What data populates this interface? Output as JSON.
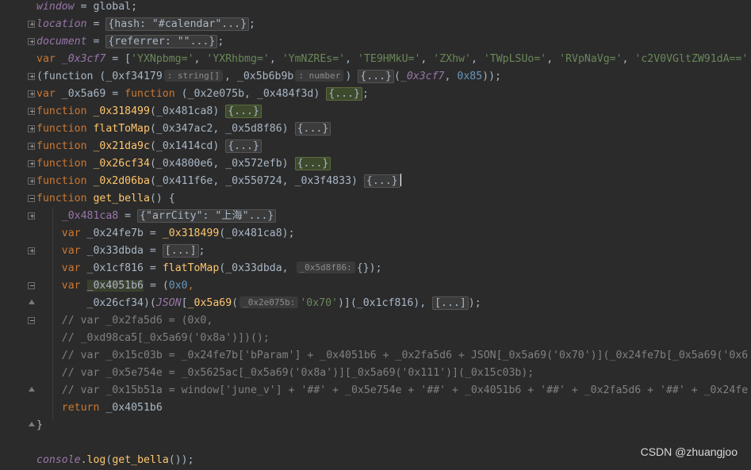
{
  "editor": {
    "lines": [
      {
        "n": 0,
        "tokens": [
          [
            "gl",
            "window"
          ],
          [
            "plain",
            " = global;"
          ]
        ]
      },
      {
        "n": 1,
        "tokens": [
          [
            "gl",
            "location"
          ],
          [
            "plain",
            " = "
          ],
          [
            "fold",
            "{hash: \"#calendar\"...}"
          ],
          [
            "plain",
            ";"
          ]
        ]
      },
      {
        "n": 2,
        "tokens": [
          [
            "gl",
            "document"
          ],
          [
            "plain",
            " = "
          ],
          [
            "fold",
            "{referrer: \"\"...}"
          ],
          [
            "plain",
            ";"
          ]
        ]
      },
      {
        "n": 3,
        "tokens": [
          [
            "kw",
            "var "
          ],
          [
            "gl",
            "_0x3cf7"
          ],
          [
            "plain",
            " = ["
          ],
          [
            "str",
            "'YXNpbmg='"
          ],
          [
            "plain",
            ", "
          ],
          [
            "str",
            "'YXRhbmg='"
          ],
          [
            "plain",
            ", "
          ],
          [
            "str",
            "'YmNZREs='"
          ],
          [
            "plain",
            ", "
          ],
          [
            "str",
            "'TE9HMkU='"
          ],
          [
            "plain",
            ", "
          ],
          [
            "str",
            "'ZXhw'"
          ],
          [
            "plain",
            ", "
          ],
          [
            "str",
            "'TWpLSUo='"
          ],
          [
            "plain",
            ", "
          ],
          [
            "str",
            "'RVpNaVg='"
          ],
          [
            "plain",
            ", "
          ],
          [
            "str",
            "'c2V0VGltZW91dA=='"
          ]
        ]
      },
      {
        "n": 4,
        "tokens": [
          [
            "plain",
            "(function (_0xf34179"
          ],
          [
            "hint",
            ": string[]"
          ],
          [
            "plain",
            ", _0x5b6b9b"
          ],
          [
            "hint",
            ": number"
          ],
          [
            "plain",
            ") "
          ],
          [
            "fold",
            "{...}"
          ],
          [
            "plain",
            "("
          ],
          [
            "gl",
            "_0x3cf7"
          ],
          [
            "plain",
            ", "
          ],
          [
            "num",
            "0x85"
          ],
          [
            "plain",
            "));"
          ]
        ]
      },
      {
        "n": 5,
        "tokens": [
          [
            "kw",
            "var "
          ],
          [
            "plain",
            "_0x5a69 = "
          ],
          [
            "kw",
            "function "
          ],
          [
            "plain",
            "(_0x2e075b, _0x484f3d) "
          ],
          [
            "foldhl",
            "{...}"
          ],
          [
            "plain",
            ";"
          ]
        ]
      },
      {
        "n": 6,
        "tokens": [
          [
            "kw",
            "function "
          ],
          [
            "fn",
            "_0x318499"
          ],
          [
            "plain",
            "(_0x481ca8) "
          ],
          [
            "foldhl",
            "{...}"
          ]
        ]
      },
      {
        "n": 7,
        "tokens": [
          [
            "kw",
            "function "
          ],
          [
            "fn",
            "flatToMap"
          ],
          [
            "plain",
            "(_0x347ac2, _0x5d8f86) "
          ],
          [
            "fold",
            "{...}"
          ]
        ]
      },
      {
        "n": 8,
        "tokens": [
          [
            "kw",
            "function "
          ],
          [
            "fn",
            "_0x21da9c"
          ],
          [
            "plain",
            "(_0x1414cd) "
          ],
          [
            "fold",
            "{...}"
          ]
        ]
      },
      {
        "n": 9,
        "tokens": [
          [
            "kw",
            "function "
          ],
          [
            "fn",
            "_0x26cf34"
          ],
          [
            "plain",
            "(_0x4800e6, _0x572efb) "
          ],
          [
            "foldhl",
            "{...}"
          ]
        ]
      },
      {
        "n": 10,
        "tokens": [
          [
            "kw",
            "function "
          ],
          [
            "fn",
            "_0x2d06ba"
          ],
          [
            "plain",
            "(_0x411f6e, _0x550724, _0x3f4833) "
          ],
          [
            "fold",
            "{...}"
          ],
          [
            "caret",
            ""
          ]
        ]
      },
      {
        "n": 11,
        "tokens": [
          [
            "kw",
            "function "
          ],
          [
            "fn",
            "get_bella"
          ],
          [
            "plain",
            "() {"
          ]
        ]
      },
      {
        "n": 12,
        "tokens": [
          [
            "plain",
            "    "
          ],
          [
            "gl2",
            "_0x481ca8"
          ],
          [
            "plain",
            " = "
          ],
          [
            "fold",
            "{\"arrCity\": \"上海\"...}"
          ]
        ]
      },
      {
        "n": 13,
        "tokens": [
          [
            "plain",
            "    "
          ],
          [
            "kw",
            "var "
          ],
          [
            "plain",
            "_0x24fe7b = "
          ],
          [
            "fn",
            "_0x318499"
          ],
          [
            "plain",
            "(_0x481ca8);"
          ]
        ]
      },
      {
        "n": 14,
        "tokens": [
          [
            "plain",
            "    "
          ],
          [
            "kw",
            "var "
          ],
          [
            "plain",
            "_0x33dbda = "
          ],
          [
            "fold",
            "[...]"
          ],
          [
            "plain",
            ";"
          ]
        ]
      },
      {
        "n": 15,
        "tokens": [
          [
            "plain",
            "    "
          ],
          [
            "kw",
            "var "
          ],
          [
            "plain",
            "_0x1cf816 = "
          ],
          [
            "fn",
            "flatToMap"
          ],
          [
            "plain",
            "(_0x33dbda, "
          ],
          [
            "hint",
            "_0x5d8f86:"
          ],
          [
            "plain",
            "{});"
          ]
        ]
      },
      {
        "n": 16,
        "tokens": [
          [
            "plain",
            "    "
          ],
          [
            "kw",
            "var "
          ],
          [
            "hlw",
            "_0x4051b6"
          ],
          [
            "plain",
            " = ("
          ],
          [
            "num",
            "0x0"
          ],
          [
            "kw",
            ","
          ]
        ]
      },
      {
        "n": 17,
        "tokens": [
          [
            "plain",
            "        _0x26cf34)("
          ],
          [
            "gli",
            "JSON"
          ],
          [
            "plain",
            "["
          ],
          [
            "fn",
            "_0x5a69"
          ],
          [
            "plain",
            "("
          ],
          [
            "hint",
            "_0x2e075b:"
          ],
          [
            "str",
            "'0x70'"
          ],
          [
            "plain",
            ")](_0x1cf816), "
          ],
          [
            "fold",
            "[...]"
          ],
          [
            "plain",
            ");"
          ]
        ]
      },
      {
        "n": 18,
        "tokens": [
          [
            "cm",
            "    // var _0x2fa5d6 = (0x0,"
          ]
        ]
      },
      {
        "n": 19,
        "tokens": [
          [
            "cm",
            "    // _0xd98ca5[_0x5a69('0x8a')])();"
          ]
        ]
      },
      {
        "n": 20,
        "tokens": [
          [
            "cm",
            "    // var _0x15c03b = _0x24fe7b['bParam'] + _0x4051b6 + _0x2fa5d6 + JSON[_0x5a69('0x70')](_0x24fe7b[_0x5a69('0x6"
          ]
        ]
      },
      {
        "n": 21,
        "tokens": [
          [
            "cm",
            "    // var _0x5e754e = _0x5625ac[_0x5a69('0x8a')][_0x5a69('0x111')](_0x15c03b);"
          ]
        ]
      },
      {
        "n": 22,
        "tokens": [
          [
            "cm",
            "    // var _0x15b51a = window['june_v'] + '##' + _0x5e754e + '##' + _0x4051b6 + '##' + _0x2fa5d6 + '##' + _0x24fe"
          ]
        ]
      },
      {
        "n": 23,
        "tokens": [
          [
            "plain",
            "    "
          ],
          [
            "kw",
            "return "
          ],
          [
            "plain",
            "_0x4051b6"
          ]
        ]
      },
      {
        "n": 24,
        "tokens": [
          [
            "plain",
            "}"
          ]
        ]
      },
      {
        "n": 25,
        "tokens": [
          [
            "plain",
            ""
          ]
        ]
      },
      {
        "n": 26,
        "tokens": [
          [
            "gli",
            "console"
          ],
          [
            "plain",
            "."
          ],
          [
            "fn",
            "log"
          ],
          [
            "plain",
            "("
          ],
          [
            "fn",
            "get_bella"
          ],
          [
            "plain",
            "());"
          ]
        ]
      }
    ]
  },
  "watermark": "CSDN @zhuangjoo",
  "colors": {
    "background": "#2b2b2b",
    "keyword": "#cc7832",
    "global": "#9876aa",
    "function": "#ffc66d",
    "string": "#6a8759",
    "number": "#6897bb",
    "comment": "#808080",
    "text": "#a9b7c6"
  }
}
